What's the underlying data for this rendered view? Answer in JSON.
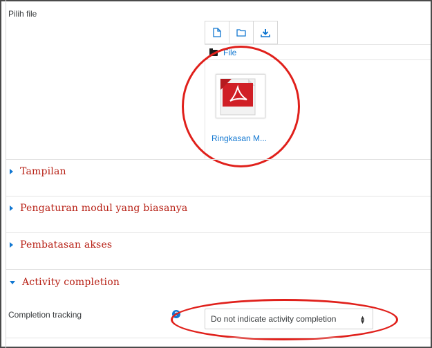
{
  "filepicker": {
    "label": "Pilih file",
    "toolbar": [
      {
        "icon": "file-icon"
      },
      {
        "icon": "folder-icon"
      },
      {
        "icon": "download-icon"
      }
    ],
    "path_label": "File",
    "file": {
      "name": "Ringkasan M...",
      "icon": "pdf-file-icon"
    }
  },
  "sections": [
    {
      "title": "Tampilan",
      "expanded": false
    },
    {
      "title": "Pengaturan modul yang biasanya",
      "expanded": false
    },
    {
      "title": "Pembatasan akses",
      "expanded": false
    },
    {
      "title": "Activity completion",
      "expanded": true
    }
  ],
  "completion": {
    "label": "Completion tracking",
    "help_icon": "help-icon",
    "selected": "Do not indicate activity completion"
  },
  "colors": {
    "link": "#1177d1",
    "section_title": "#b72015",
    "highlight": "#e0201b"
  }
}
